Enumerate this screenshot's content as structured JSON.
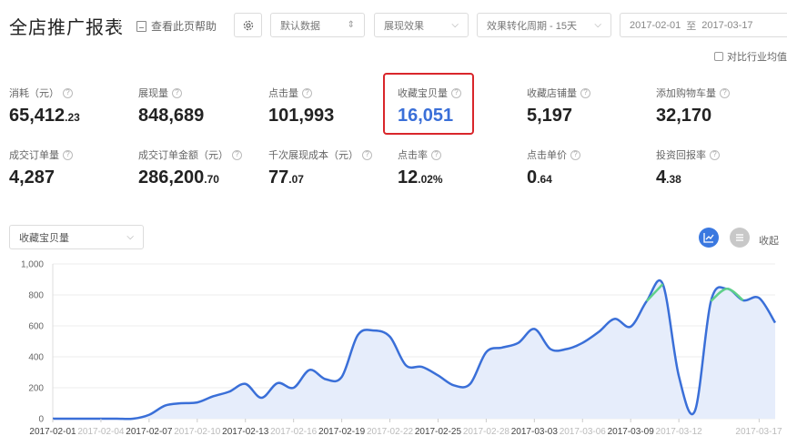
{
  "header": {
    "title": "全店推广报表",
    "help_label": "查看此页帮助",
    "data_select": "默认数据",
    "effect_select": "展现效果",
    "period_select": "效果转化周期 - 15天",
    "date_start": "2017-02-01",
    "date_sep": "至",
    "date_end": "2017-03-17",
    "compare_label": "对比行业均值"
  },
  "metrics": [
    {
      "label": "消耗（元）",
      "int": "65,412",
      "dec": ".23"
    },
    {
      "label": "展现量",
      "int": "848,689",
      "dec": ""
    },
    {
      "label": "点击量",
      "int": "101,993",
      "dec": ""
    },
    {
      "label": "收藏宝贝量",
      "int": "16,051",
      "dec": ""
    },
    {
      "label": "收藏店铺量",
      "int": "5,197",
      "dec": ""
    },
    {
      "label": "添加购物车量",
      "int": "32,170",
      "dec": ""
    },
    {
      "label": "成交订单量",
      "int": "4,287",
      "dec": ""
    },
    {
      "label": "成交订单金额（元）",
      "int": "286,200",
      "dec": ".70"
    },
    {
      "label": "千次展现成本（元）",
      "int": "77",
      "dec": ".07"
    },
    {
      "label": "点击率",
      "int": "12",
      "dec": ".02%"
    },
    {
      "label": "点击单价",
      "int": "0",
      "dec": ".64"
    },
    {
      "label": "投资回报率",
      "int": "4",
      "dec": ".38"
    }
  ],
  "chart_controls": {
    "metric_select": "收藏宝贝量",
    "collapse_label": "收起"
  },
  "colors": {
    "accent": "#3a78e0",
    "line": "#3a6fd8",
    "area": "#e6edfb",
    "highlight": "#d9262b",
    "peak": "#5fd08a"
  },
  "chart_data": {
    "type": "area",
    "y_ticks": [
      "0",
      "200",
      "400",
      "600",
      "800",
      "1,000"
    ],
    "ylim": [
      0,
      1000
    ],
    "x_tick_labels": [
      {
        "label": "2017-02-01",
        "i": 0,
        "bold": true
      },
      {
        "label": "2017-02-04",
        "i": 3,
        "bold": false
      },
      {
        "label": "2017-02-07",
        "i": 6,
        "bold": true
      },
      {
        "label": "2017-02-10",
        "i": 9,
        "bold": false
      },
      {
        "label": "2017-02-13",
        "i": 12,
        "bold": true
      },
      {
        "label": "2017-02-16",
        "i": 15,
        "bold": false
      },
      {
        "label": "2017-02-19",
        "i": 18,
        "bold": true
      },
      {
        "label": "2017-02-22",
        "i": 21,
        "bold": false
      },
      {
        "label": "2017-02-25",
        "i": 24,
        "bold": true
      },
      {
        "label": "2017-02-28",
        "i": 27,
        "bold": false
      },
      {
        "label": "2017-03-03",
        "i": 30,
        "bold": true
      },
      {
        "label": "2017-03-06",
        "i": 33,
        "bold": false
      },
      {
        "label": "2017-03-09",
        "i": 36,
        "bold": true
      },
      {
        "label": "2017-03-12",
        "i": 39,
        "bold": false
      },
      {
        "label": "2017-03-17",
        "i": 44,
        "bold": false
      }
    ],
    "values": [
      0,
      0,
      0,
      0,
      0,
      0,
      25,
      85,
      100,
      105,
      145,
      175,
      225,
      135,
      230,
      200,
      315,
      255,
      270,
      540,
      570,
      530,
      345,
      335,
      280,
      215,
      225,
      430,
      460,
      490,
      580,
      450,
      450,
      490,
      560,
      645,
      595,
      760,
      870,
      275,
      50,
      760,
      840,
      765,
      780,
      620
    ]
  }
}
